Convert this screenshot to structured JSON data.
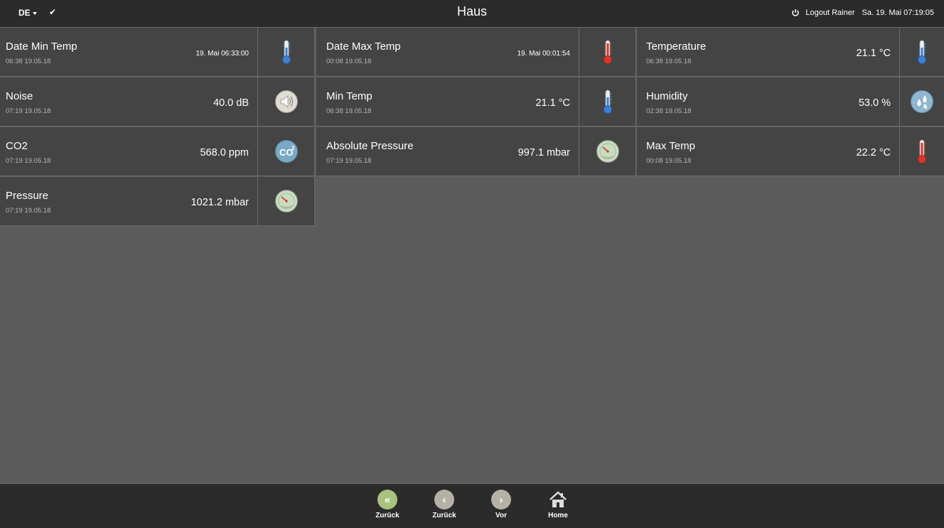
{
  "header": {
    "language": "DE",
    "title": "Haus",
    "logout_label": "Logout Rainer",
    "datetime": "Sa. 19. Mai 07:19:05"
  },
  "tiles": [
    {
      "name": "Date Min Temp",
      "time": "06:38 19.05.18",
      "value": "19. Mai 06:33:00",
      "icon": "thermometer-cold-icon"
    },
    {
      "name": "Date Max Temp",
      "time": "00:08 19.05.18",
      "value": "19. Mai 00:01:54",
      "icon": "thermometer-hot-icon"
    },
    {
      "name": "Temperature",
      "time": "06:38 19.05.18",
      "value": "21.1 °C",
      "icon": "thermometer-cold-icon"
    },
    {
      "name": "Noise",
      "time": "07:19 19.05.18",
      "value": "40.0 dB",
      "icon": "speaker-icon"
    },
    {
      "name": "Min Temp",
      "time": "06:38 19.05.18",
      "value": "21.1 °C",
      "icon": "thermometer-cold-icon"
    },
    {
      "name": "Humidity",
      "time": "02:38 19.05.18",
      "value": "53.0 %",
      "icon": "humidity-drops-icon"
    },
    {
      "name": "CO2",
      "time": "07:19 19.05.18",
      "value": "568.0 ppm",
      "icon": "co2-icon"
    },
    {
      "name": "Absolute Pressure",
      "time": "07:19 19.05.18",
      "value": "997.1 mbar",
      "icon": "barometer-icon"
    },
    {
      "name": "Max Temp",
      "time": "00:08 19.05.18",
      "value": "22.2 °C",
      "icon": "thermometer-hot-icon"
    },
    {
      "name": "Pressure",
      "time": "07:19 19.05.18",
      "value": "1021.2 mbar",
      "icon": "barometer-icon"
    }
  ],
  "footer": {
    "buttons": [
      {
        "label": "Zurück",
        "icon": "double-chevron-left-icon"
      },
      {
        "label": "Zurück",
        "icon": "chevron-left-icon"
      },
      {
        "label": "Vor",
        "icon": "chevron-right-icon"
      },
      {
        "label": "Home",
        "icon": "home-icon"
      }
    ]
  },
  "colors": {
    "topbar": "#2b2b2b",
    "tile": "#444444",
    "background": "#5c5c5c",
    "thermo_cold": "#3b7fd6",
    "thermo_hot": "#d9372a"
  }
}
